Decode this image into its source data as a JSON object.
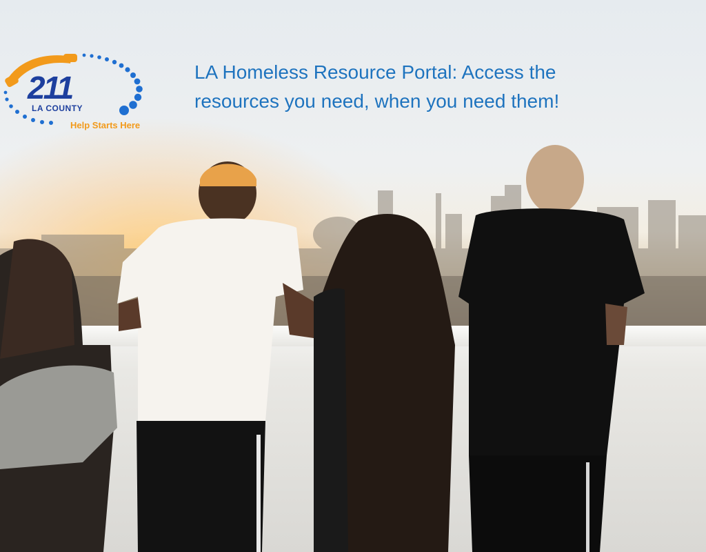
{
  "logo": {
    "number": "211",
    "region": "LA COUNTY",
    "tagline": "Help Starts Here",
    "colors": {
      "primary": "#1d3f9e",
      "accent": "#f29a1b",
      "dots": "#1f6fd1"
    }
  },
  "headline": {
    "line1": "LA Homeless Resource Portal: Access the",
    "line2": "resources you need, when you need them!"
  },
  "hero_image": {
    "icon": "group-on-rooftop-photo"
  }
}
